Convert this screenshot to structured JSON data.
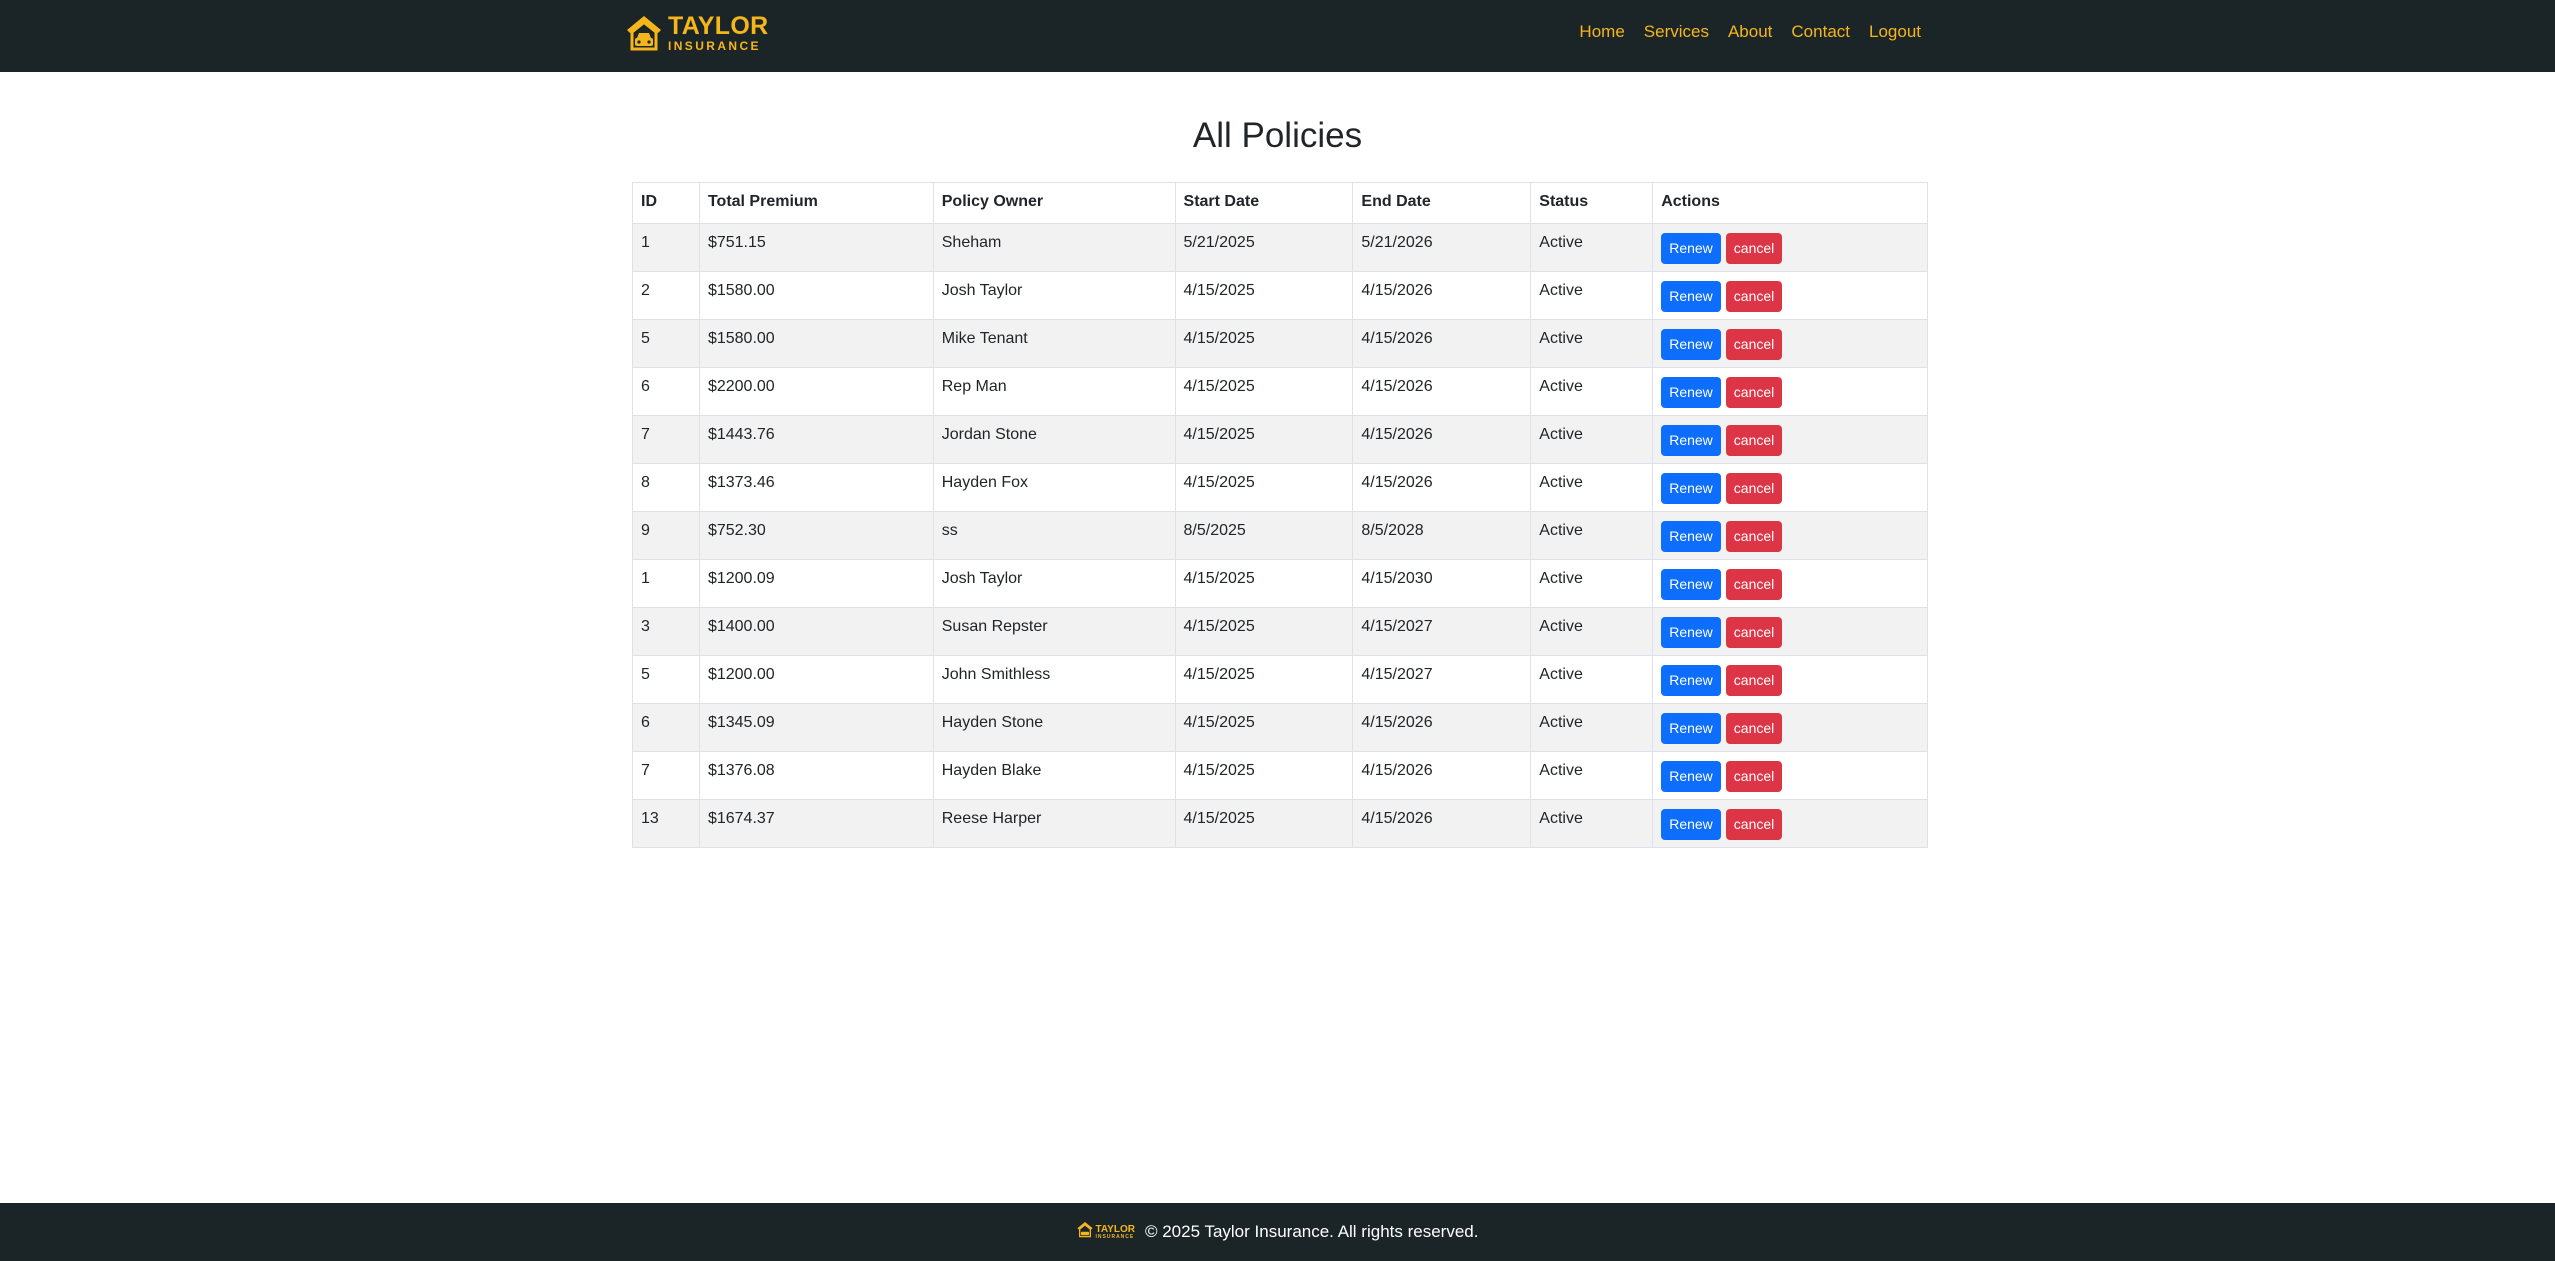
{
  "brand": {
    "name": "TAYLOR",
    "sub": "INSURANCE"
  },
  "nav": {
    "items": [
      "Home",
      "Services",
      "About",
      "Contact",
      "Logout"
    ]
  },
  "page": {
    "title": "All Policies"
  },
  "table": {
    "headers": [
      "ID",
      "Total Premium",
      "Policy Owner",
      "Start Date",
      "End Date",
      "Status",
      "Actions"
    ],
    "rows": [
      [
        "1",
        "$751.15",
        "Sheham",
        "5/21/2025",
        "5/21/2026",
        "Active"
      ],
      [
        "2",
        "$1580.00",
        "Josh Taylor",
        "4/15/2025",
        "4/15/2026",
        "Active"
      ],
      [
        "5",
        "$1580.00",
        "Mike Tenant",
        "4/15/2025",
        "4/15/2026",
        "Active"
      ],
      [
        "6",
        "$2200.00",
        "Rep Man",
        "4/15/2025",
        "4/15/2026",
        "Active"
      ],
      [
        "7",
        "$1443.76",
        "Jordan Stone",
        "4/15/2025",
        "4/15/2026",
        "Active"
      ],
      [
        "8",
        "$1373.46",
        "Hayden Fox",
        "4/15/2025",
        "4/15/2026",
        "Active"
      ],
      [
        "9",
        "$752.30",
        "ss",
        "8/5/2025",
        "8/5/2028",
        "Active"
      ],
      [
        "1",
        "$1200.09",
        "Josh Taylor",
        "4/15/2025",
        "4/15/2030",
        "Active"
      ],
      [
        "3",
        "$1400.00",
        "Susan Repster",
        "4/15/2025",
        "4/15/2027",
        "Active"
      ],
      [
        "5",
        "$1200.00",
        "John Smithless",
        "4/15/2025",
        "4/15/2027",
        "Active"
      ],
      [
        "6",
        "$1345.09",
        "Hayden Stone",
        "4/15/2025",
        "4/15/2026",
        "Active"
      ],
      [
        "7",
        "$1376.08",
        "Hayden Blake",
        "4/15/2025",
        "4/15/2026",
        "Active"
      ],
      [
        "13",
        "$1674.37",
        "Reese Harper",
        "4/15/2025",
        "4/15/2026",
        "Active"
      ]
    ],
    "renew_label": "Renew",
    "cancel_label": "cancel"
  },
  "footer": {
    "brand_name": "TAYLOR",
    "brand_sub": "INSURANCE",
    "text": "© 2025 Taylor Insurance. All rights reserved."
  },
  "colors": {
    "header_bg": "#1b2426",
    "accent": "#f5b61c",
    "renew": "#0d6efd",
    "cancel": "#dc3545"
  },
  "icons": {
    "logo": "house-car-icon"
  }
}
